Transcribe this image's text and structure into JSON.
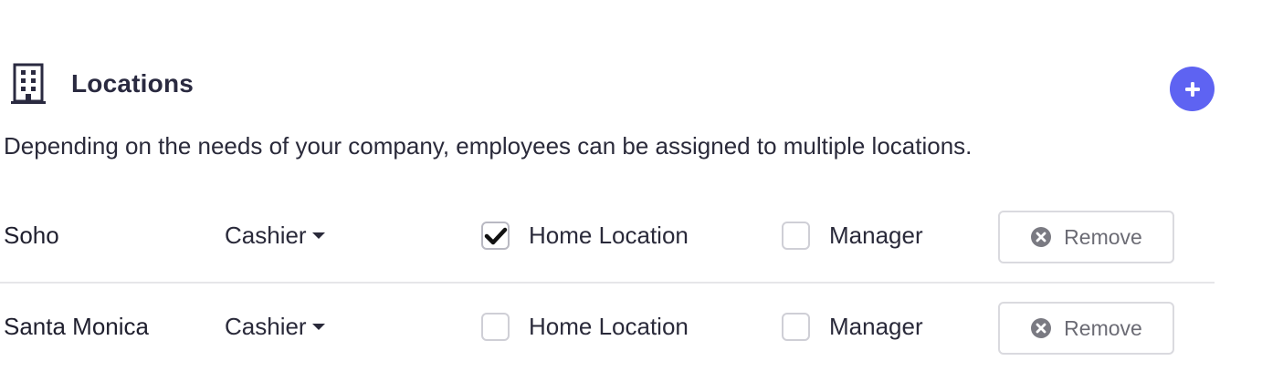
{
  "section": {
    "title": "Locations",
    "icon": "building-icon",
    "add_icon": "plus-icon",
    "description": "Depending on the needs of your company, employees can be assigned to multiple locations."
  },
  "colors": {
    "accent": "#5e63f2",
    "text": "#2a2a3a",
    "divider": "#e6e6e9",
    "remove_text": "#6b6b74"
  },
  "locations": [
    {
      "name": "Soho",
      "role": "Cashier",
      "home_location": {
        "label": "Home Location",
        "checked": true
      },
      "manager": {
        "label": "Manager",
        "checked": false
      },
      "remove_label": "Remove"
    },
    {
      "name": "Santa Monica",
      "role": "Cashier",
      "home_location": {
        "label": "Home Location",
        "checked": false
      },
      "manager": {
        "label": "Manager",
        "checked": false
      },
      "remove_label": "Remove"
    }
  ]
}
